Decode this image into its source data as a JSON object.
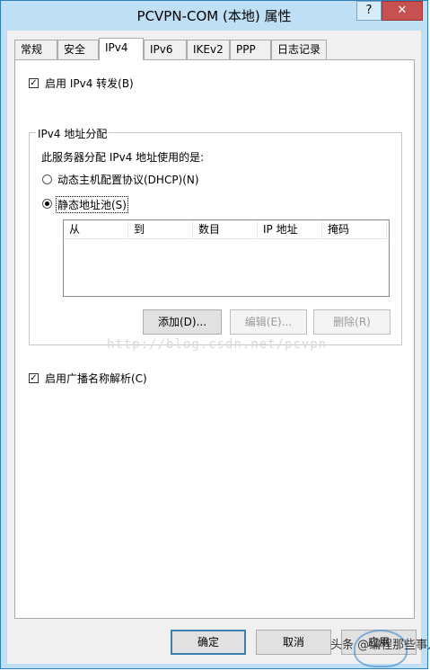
{
  "window": {
    "title": "PCVPN-COM (本地) 属性",
    "help_label": "?",
    "close_label": "✕"
  },
  "tabs": [
    {
      "label": "常规"
    },
    {
      "label": "安全"
    },
    {
      "label": "IPv4"
    },
    {
      "label": "IPv6"
    },
    {
      "label": "IKEv2"
    },
    {
      "label": "PPP"
    },
    {
      "label": "日志记录"
    }
  ],
  "active_tab": "IPv4",
  "ipv4": {
    "enable_forwarding": {
      "label": "启用 IPv4 转发(B)",
      "checked": true
    },
    "group_title": "IPv4 地址分配",
    "instruction": "此服务器分配 IPv4 地址使用的是:",
    "radio_dhcp": {
      "label": "动态主机配置协议(DHCP)(N)",
      "selected": false
    },
    "radio_static": {
      "label": "静态地址池(S)",
      "selected": true
    },
    "table": {
      "columns": [
        "从",
        "到",
        "数目",
        "IP 地址",
        "掩码"
      ],
      "rows": []
    },
    "buttons": {
      "add": "添加(D)...",
      "edit": "编辑(E)...",
      "delete": "删除(R)"
    },
    "enable_broadcast": {
      "label": "启用广播名称解析(C)",
      "checked": true
    }
  },
  "footer": {
    "ok": "确定",
    "cancel": "取消",
    "apply": "应用"
  },
  "watermark": "http://blog.csdn.net/pcvpn",
  "brand_watermark": "头条 @编程那些事儿"
}
